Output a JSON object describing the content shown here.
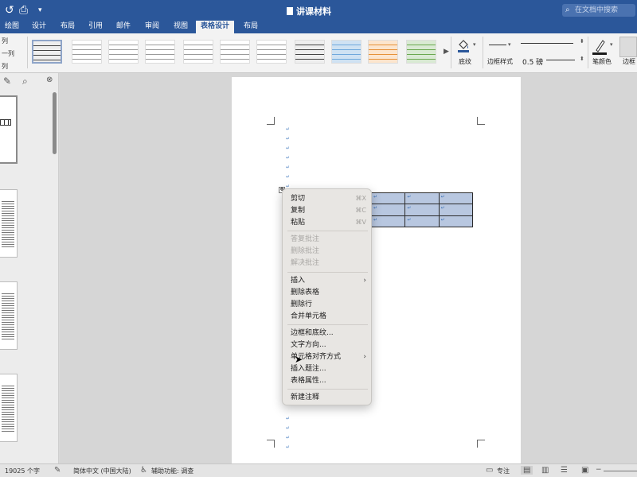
{
  "window": {
    "title": "讲课材料",
    "search_placeholder": "在文档中搜索"
  },
  "tabs": [
    {
      "label": "绘图"
    },
    {
      "label": "设计"
    },
    {
      "label": "布局"
    },
    {
      "label": "引用"
    },
    {
      "label": "邮件"
    },
    {
      "label": "审阅"
    },
    {
      "label": "视图"
    },
    {
      "label": "表格设计",
      "active": true
    },
    {
      "label": "布局"
    }
  ],
  "ribbon": {
    "left_labels": [
      "列",
      "一列",
      "列"
    ],
    "shading_label": "底纹",
    "border_style_label": "边框样式",
    "line_width": "0.5 磅",
    "pen_color_label": "笔颜色",
    "borders_label": "边框"
  },
  "document": {
    "para_mark": "↵",
    "table_cell_mark": "↵"
  },
  "context_menu": {
    "items": [
      {
        "label": "剪切",
        "shortcut": "⌘X"
      },
      {
        "label": "复制",
        "shortcut": "⌘C"
      },
      {
        "label": "粘贴",
        "shortcut": "⌘V"
      },
      {
        "label": "答复批注",
        "disabled": true
      },
      {
        "label": "删除批注",
        "disabled": true
      },
      {
        "label": "解决批注",
        "disabled": true
      },
      {
        "label": "插入",
        "submenu": true
      },
      {
        "label": "删除表格"
      },
      {
        "label": "删除行"
      },
      {
        "label": "合并单元格"
      },
      {
        "label": "边框和底纹..."
      },
      {
        "label": "文字方向..."
      },
      {
        "label": "单元格对齐方式",
        "submenu": true
      },
      {
        "label": "插入题注..."
      },
      {
        "label": "表格属性..."
      },
      {
        "label": "新建注释"
      }
    ],
    "submenu_arrow": "›"
  },
  "status": {
    "word_count": "19025 个字",
    "language": "简体中文 (中国大陆)",
    "accessibility": "辅助功能: 调查",
    "focus": "专注"
  }
}
